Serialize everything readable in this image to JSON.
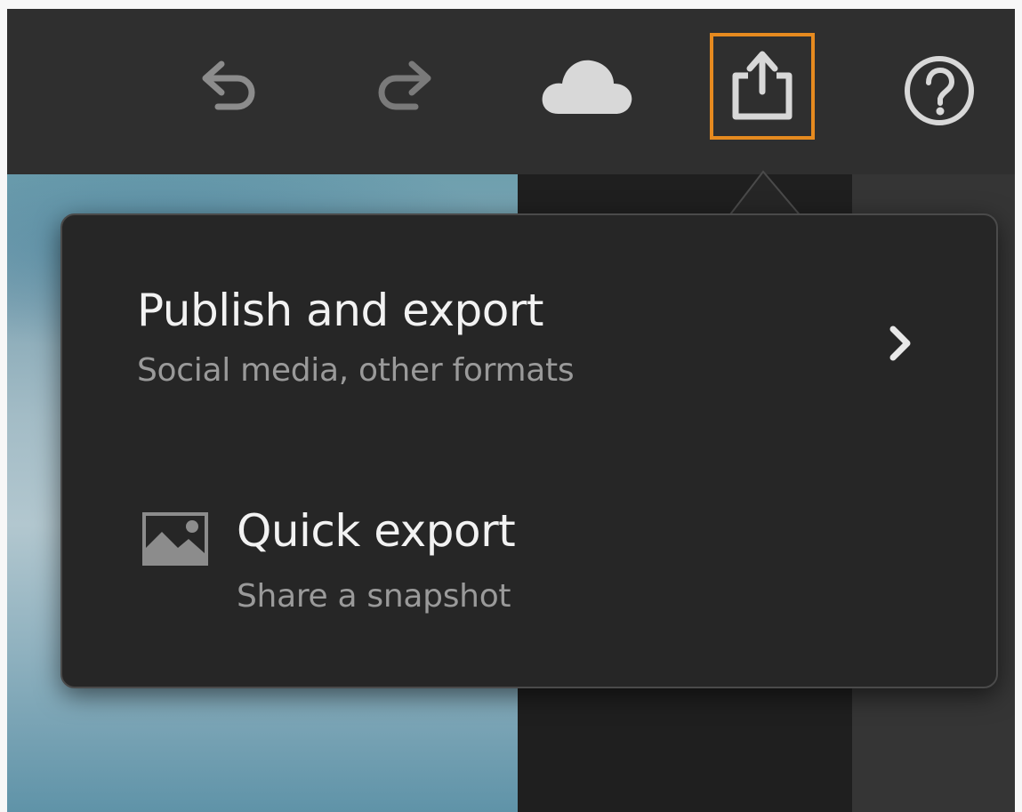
{
  "toolbar": {
    "buttons": [
      {
        "name": "undo",
        "icon": "undo-icon"
      },
      {
        "name": "redo",
        "icon": "redo-icon"
      },
      {
        "name": "cloud",
        "icon": "cloud-icon"
      },
      {
        "name": "share",
        "icon": "share-export-icon",
        "highlighted": true
      },
      {
        "name": "help",
        "icon": "help-icon"
      }
    ],
    "highlight_color": "#e68a1f"
  },
  "menu": {
    "publish": {
      "title": "Publish and export",
      "subtitle": "Social media, other formats",
      "icon": "chevron-right-icon"
    },
    "quick": {
      "title": "Quick export",
      "subtitle": "Share a snapshot",
      "icon": "image-icon"
    }
  },
  "colors": {
    "toolbar_bg": "#2f2f2f",
    "popover_bg": "#262626",
    "title_text": "#f2f2f2",
    "subtitle_text": "#9a9a9a",
    "icon_light": "#d8d8d8",
    "icon_dim": "#8c8c8c"
  }
}
